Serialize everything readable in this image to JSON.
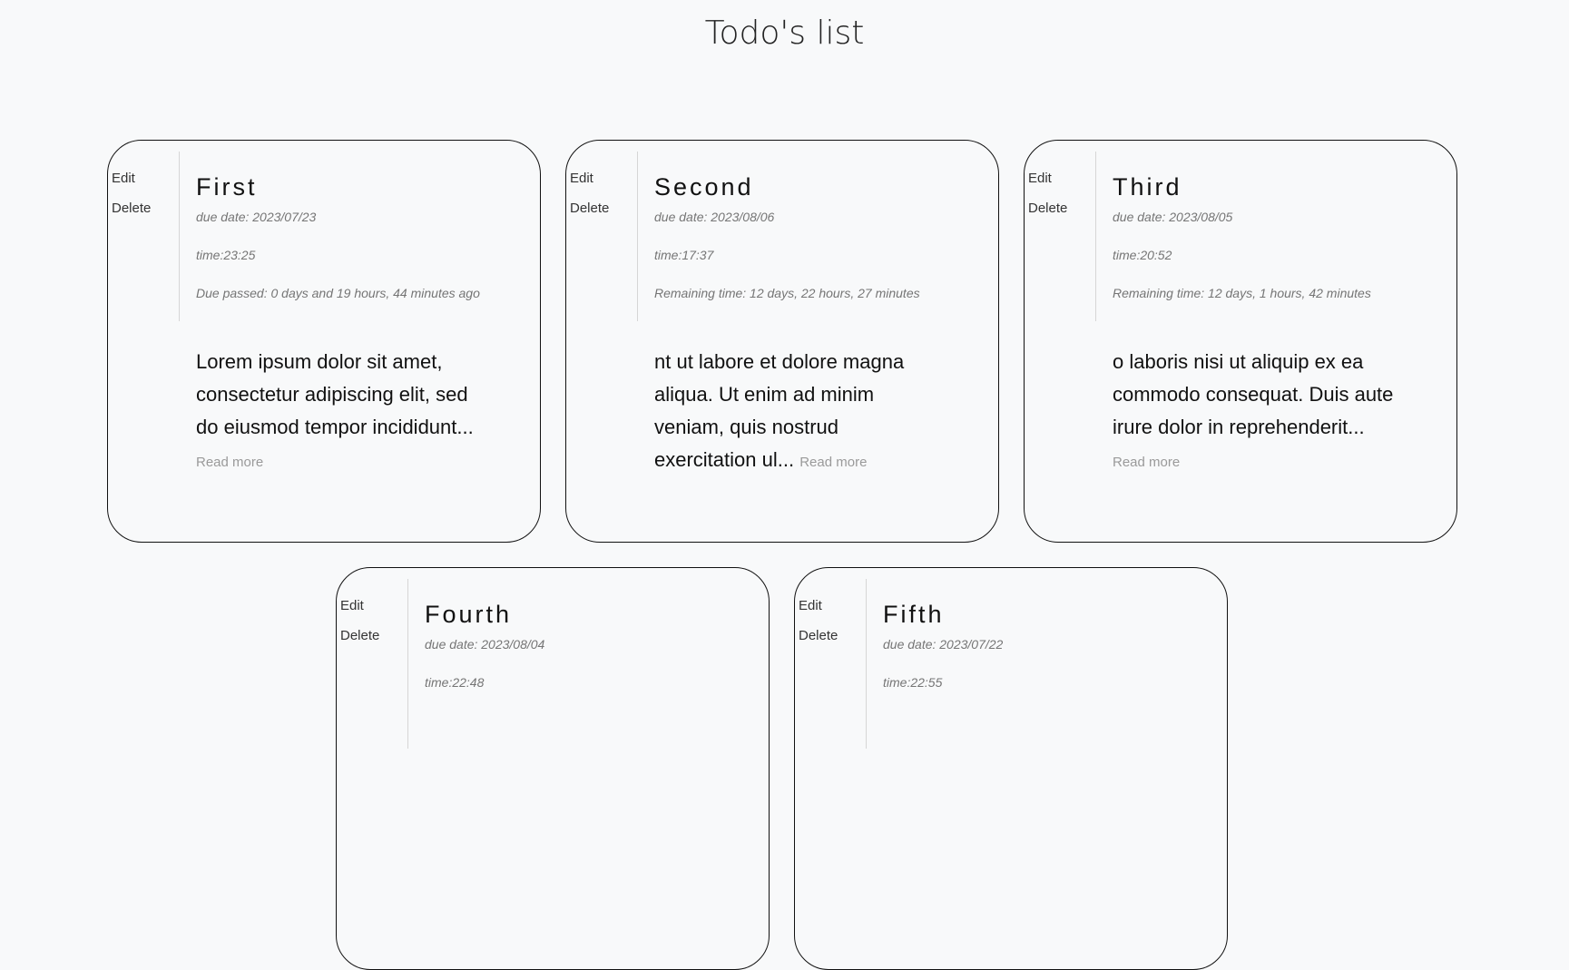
{
  "page": {
    "title": "Todo's list"
  },
  "todos": [
    {
      "edit_label": "Edit",
      "delete_label": "Delete",
      "title": "First",
      "due_date": "due date: 2023/07/23",
      "time": "time:23:25",
      "status": "Due passed: 0 days and 19 hours, 44 minutes ago",
      "description": "Lorem ipsum dolor sit amet, consectetur adipiscing elit, sed do eiusmod tempor incididunt...",
      "read_more": "Read more"
    },
    {
      "edit_label": "Edit",
      "delete_label": "Delete",
      "title": "Second",
      "due_date": "due date: 2023/08/06",
      "time": "time:17:37",
      "status": "Remaining time: 12 days, 22 hours, 27 minutes",
      "description": "nt ut labore et dolore magna aliqua. Ut enim ad minim veniam, quis nostrud exercitation ul...",
      "read_more": "Read more"
    },
    {
      "edit_label": "Edit",
      "delete_label": "Delete",
      "title": "Third",
      "due_date": "due date: 2023/08/05",
      "time": "time:20:52",
      "status": "Remaining time: 12 days, 1 hours, 42 minutes",
      "description": "o laboris nisi ut aliquip ex ea commodo consequat. Duis aute irure dolor in reprehenderit...",
      "read_more": "Read more"
    },
    {
      "edit_label": "Edit",
      "delete_label": "Delete",
      "title": "Fourth",
      "due_date": "due date: 2023/08/04",
      "time": "time:22:48"
    },
    {
      "edit_label": "Edit",
      "delete_label": "Delete",
      "title": "Fifth",
      "due_date": "due date: 2023/07/22",
      "time": "time:22:55"
    }
  ]
}
